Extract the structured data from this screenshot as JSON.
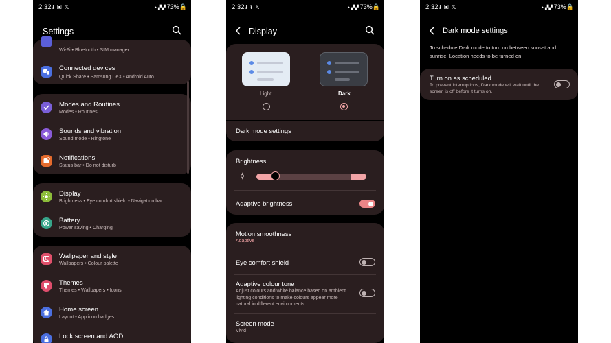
{
  "colors": {
    "card": "#2a1e1f",
    "accent": "#f2a4a6",
    "toggle_on": "#ec8587",
    "subtext": "#c8b9b9",
    "icon_wifi": "#5b5fd8",
    "icon_connected": "#4b6fe0",
    "icon_modes": "#7a5fd8",
    "icon_sounds": "#8a5bd8",
    "icon_notifications": "#e56b2d",
    "icon_display": "#8dbd3a",
    "icon_battery": "#37a58a",
    "icon_wallpaper": "#e0506b",
    "icon_themes": "#e04e6d",
    "icon_home": "#4b6fe0",
    "icon_lock": "#4b6fe0"
  },
  "status": {
    "time": "2:32",
    "battery": "73%",
    "notif_icons": [
      "download-icon",
      "image-icon",
      "x-icon"
    ]
  },
  "settings": {
    "title": "Settings",
    "search_icon": "search-icon",
    "wifi_partial_sub": "Wi-Fi • Bluetooth • SIM manager",
    "items": [
      {
        "title": "Connected devices",
        "sub": "Quick Share • Samsung DeX • Android Auto",
        "icon": "devices-icon"
      },
      {
        "title": "Modes and Routines",
        "sub": "Modes • Routines",
        "icon": "check-circle-icon"
      },
      {
        "title": "Sounds and vibration",
        "sub": "Sound mode • Ringtone",
        "icon": "speaker-icon"
      },
      {
        "title": "Notifications",
        "sub": "Status bar • Do not disturb",
        "icon": "bell-icon"
      },
      {
        "title": "Display",
        "sub": "Brightness • Eye comfort shield • Navigation bar",
        "icon": "sun-icon"
      },
      {
        "title": "Battery",
        "sub": "Power saving • Charging",
        "icon": "battery-icon"
      },
      {
        "title": "Wallpaper and style",
        "sub": "Wallpapers • Colour palette",
        "icon": "image-icon"
      },
      {
        "title": "Themes",
        "sub": "Themes • Wallpapers • Icons",
        "icon": "themes-icon"
      },
      {
        "title": "Home screen",
        "sub": "Layout • App icon badges",
        "icon": "home-icon"
      },
      {
        "title": "Lock screen and AOD",
        "sub": "",
        "icon": "lock-icon"
      }
    ]
  },
  "display": {
    "title": "Display",
    "light_label": "Light",
    "dark_label": "Dark",
    "selected_mode": "Dark",
    "dark_mode_settings": "Dark mode settings",
    "brightness_label": "Brightness",
    "brightness_level": 0.17,
    "adaptive_brightness": "Adaptive brightness",
    "adaptive_brightness_on": true,
    "motion_smoothness": "Motion smoothness",
    "motion_smoothness_value": "Adaptive",
    "eye_comfort": "Eye comfort shield",
    "eye_comfort_on": false,
    "adaptive_colour": "Adaptive colour tone",
    "adaptive_colour_desc": "Adjust colours and white balance based on ambient lighting conditions to make colours appear more natural in different environments.",
    "adaptive_colour_on": false,
    "screen_mode": "Screen mode",
    "screen_mode_value": "Vivid"
  },
  "darkmode": {
    "title": "Dark mode settings",
    "intro": "To schedule Dark mode to turn on between sunset and sunrise, Location needs to be turned on.",
    "scheduled_label": "Turn on as scheduled",
    "scheduled_desc": "To prevent interruptions, Dark mode will wait until the screen is off before it turns on.",
    "scheduled_on": false
  }
}
